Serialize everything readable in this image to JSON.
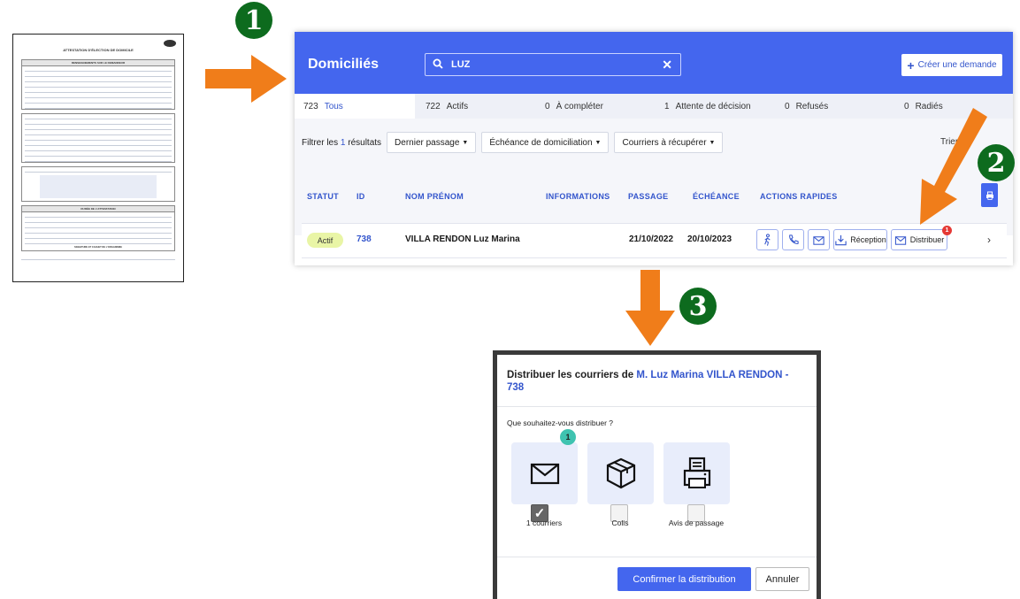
{
  "document": {
    "title": "ATTESTATION D'ÉLECTION DE DOMICILE",
    "sections": [
      "RENSEIGNEMENTS SUR LE DEMANDEUR",
      "DURÉE DE L'ATTESTATION"
    ],
    "footer": "SIGNATURE ET CACHET DE L'ORGANISME"
  },
  "steps": {
    "step1": "1",
    "step2": "2",
    "step3": "3"
  },
  "colors": {
    "accent": "#4466ee",
    "arrow": "#f07d1a",
    "step_badge": "#0d6b1e",
    "status_actif": "#e9f5a6",
    "alert": "#e53935",
    "teal": "#3fc3b0"
  },
  "header": {
    "title": "Domiciliés",
    "search": {
      "icon": "search-icon",
      "value": "LUZ",
      "clear_icon": "close-icon"
    },
    "create_button": "Créer une demande"
  },
  "tabs": [
    {
      "count": "723",
      "label": "Tous"
    },
    {
      "count": "722",
      "label": "Actifs"
    },
    {
      "count": "0",
      "label": "À compléter"
    },
    {
      "count": "1",
      "label": "Attente de décision"
    },
    {
      "count": "0",
      "label": "Refusés"
    },
    {
      "count": "0",
      "label": "Radiés"
    }
  ],
  "filters": {
    "label_prefix": "Filtrer les",
    "label_count": "1",
    "label_suffix": "résultats",
    "dropdowns": [
      "Dernier passage",
      "Échéance de domiciliation",
      "Courriers à récupérer"
    ],
    "sort_label": "Trier"
  },
  "table": {
    "headers": [
      "STATUT",
      "ID",
      "NOM PRÉNOM",
      "INFORMATIONS",
      "PASSAGE",
      "ÉCHÉANCE",
      "ACTIONS RAPIDES"
    ],
    "row": {
      "status": "Actif",
      "id": "738",
      "name": "VILLA RENDON Luz Marina",
      "passage": "21/10/2022",
      "echeance": "20/10/2023",
      "actions": {
        "reception": "Réception",
        "distribuer": "Distribuer",
        "badge": "1"
      }
    }
  },
  "modal": {
    "title_prefix": "Distribuer les courriers de",
    "title_name": "M. Luz Marina VILLA RENDON -",
    "title_id": "738",
    "question": "Que souhaitez-vous distribuer ?",
    "options": [
      {
        "icon": "envelope-icon",
        "label": "1 courriers",
        "checked": true,
        "badge": "1"
      },
      {
        "icon": "package-icon",
        "label": "Colis",
        "checked": false
      },
      {
        "icon": "printer-icon",
        "label": "Avis de passage",
        "checked": false
      }
    ],
    "confirm": "Confirmer la distribution",
    "cancel": "Annuler"
  }
}
